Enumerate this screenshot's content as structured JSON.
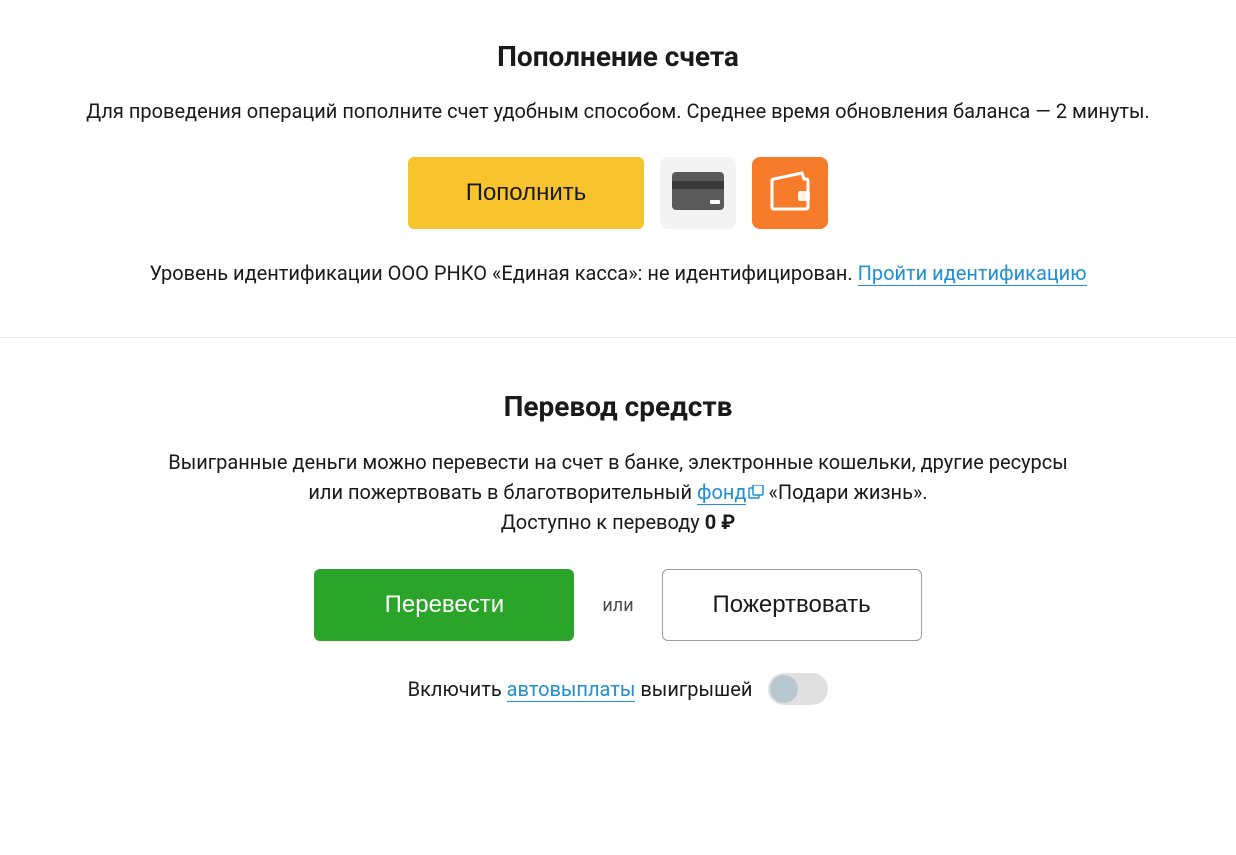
{
  "deposit": {
    "title": "Пополнение счета",
    "description": "Для проведения операций пополните счет удобным способом. Среднее время обновления баланса — 2 минуты.",
    "button_label": "Пополнить",
    "identification_text": "Уровень идентификации ООО РНКО «Единая касса»: не идентифицирован. ",
    "identification_link": "Пройти идентификацию"
  },
  "transfer": {
    "title": "Перевод средств",
    "description_line1": "Выигранные деньги можно перевести на счет в банке, электронные кошельки, другие ресурсы",
    "description_line2_pre": "или пожертвовать в благотворительный ",
    "fund_link": "фонд",
    "description_line2_post": "«Подари жизнь».",
    "available_label": "Доступно к переводу ",
    "available_amount": "0 ₽",
    "transfer_button": "Перевести",
    "or_text": "или",
    "donate_button": "Пожертвовать",
    "autopay_pre": "Включить ",
    "autopay_link": "автовыплаты",
    "autopay_post": " выигрышей"
  }
}
